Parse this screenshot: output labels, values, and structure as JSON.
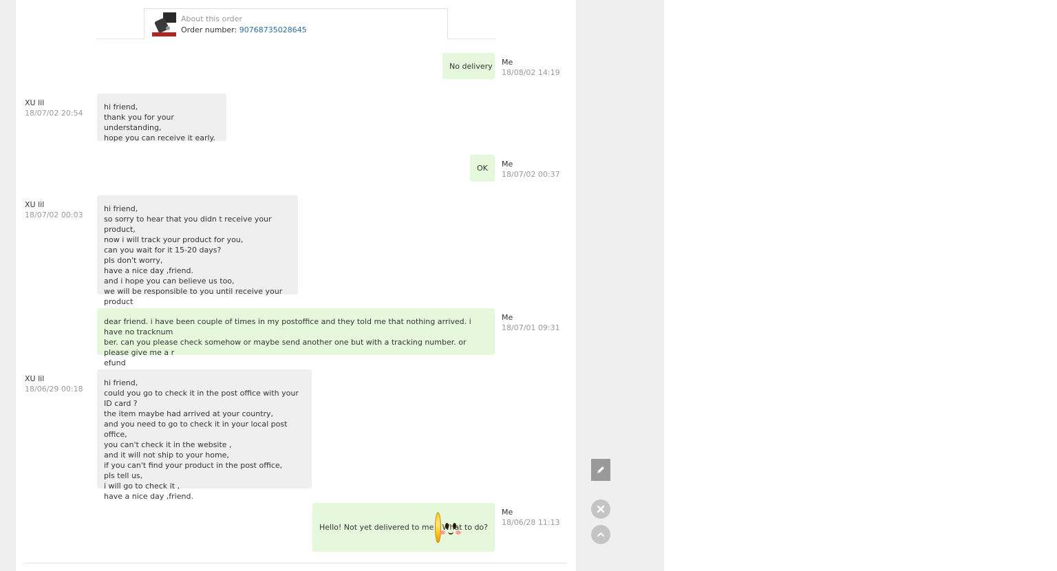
{
  "order": {
    "title": "About this order",
    "number_label": "Order number:",
    "number": "90768735028645"
  },
  "messages": [
    {
      "sender": "Me",
      "time": "18/08/02 14:19",
      "text": "No delivery"
    },
    {
      "sender": "XU lil",
      "time": "18/07/02 20:54",
      "text": "hi friend,\nthank you for your understanding,\nhope you can receive it early."
    },
    {
      "sender": "Me",
      "time": "18/07/02 00:37",
      "text": "OK"
    },
    {
      "sender": "XU lil",
      "time": "18/07/02 00:03",
      "text": "hi friend,\nso sorry to hear that you didn t receive your product,\nnow i will track your product for you,\ncan you wait for it 15-20 days?\npls don't worry,\nhave a nice day ,friend.\nand i hope you can believe us too,\nwe will be responsible to you until receive your product"
    },
    {
      "sender": "Me",
      "time": "18/07/01 09:31",
      "text": "dear friend. i have been couple of times in my postoffice and they told me that nothing arrived. i have no tracknum\nber. can you please check somehow or maybe send another one but with a tracking number. or please give me a r\nefund"
    },
    {
      "sender": "XU lil",
      "time": "18/06/29 00:18",
      "text": "hi friend,\ncould you go to check it in the post office with your ID card ?\nthe item maybe had arrived at your country,\nand you need to go to check it in your local post office,\nyou can't check it in the website ,\nand it will not ship to your home,\nif you can't find your product in the post office,\npls tell us,\ni will go to check it ,\nhave a nice day ,friend."
    },
    {
      "sender": "Me",
      "time": "18/06/28 11:13",
      "text_before": "Hello! Not yet delivered to me",
      "text_after": "What to do?",
      "emoji": "smiley-face"
    }
  ],
  "tools": {
    "edit_icon": "pencil-icon",
    "close_icon": "close-icon",
    "top_icon": "chevron-up-icon"
  }
}
